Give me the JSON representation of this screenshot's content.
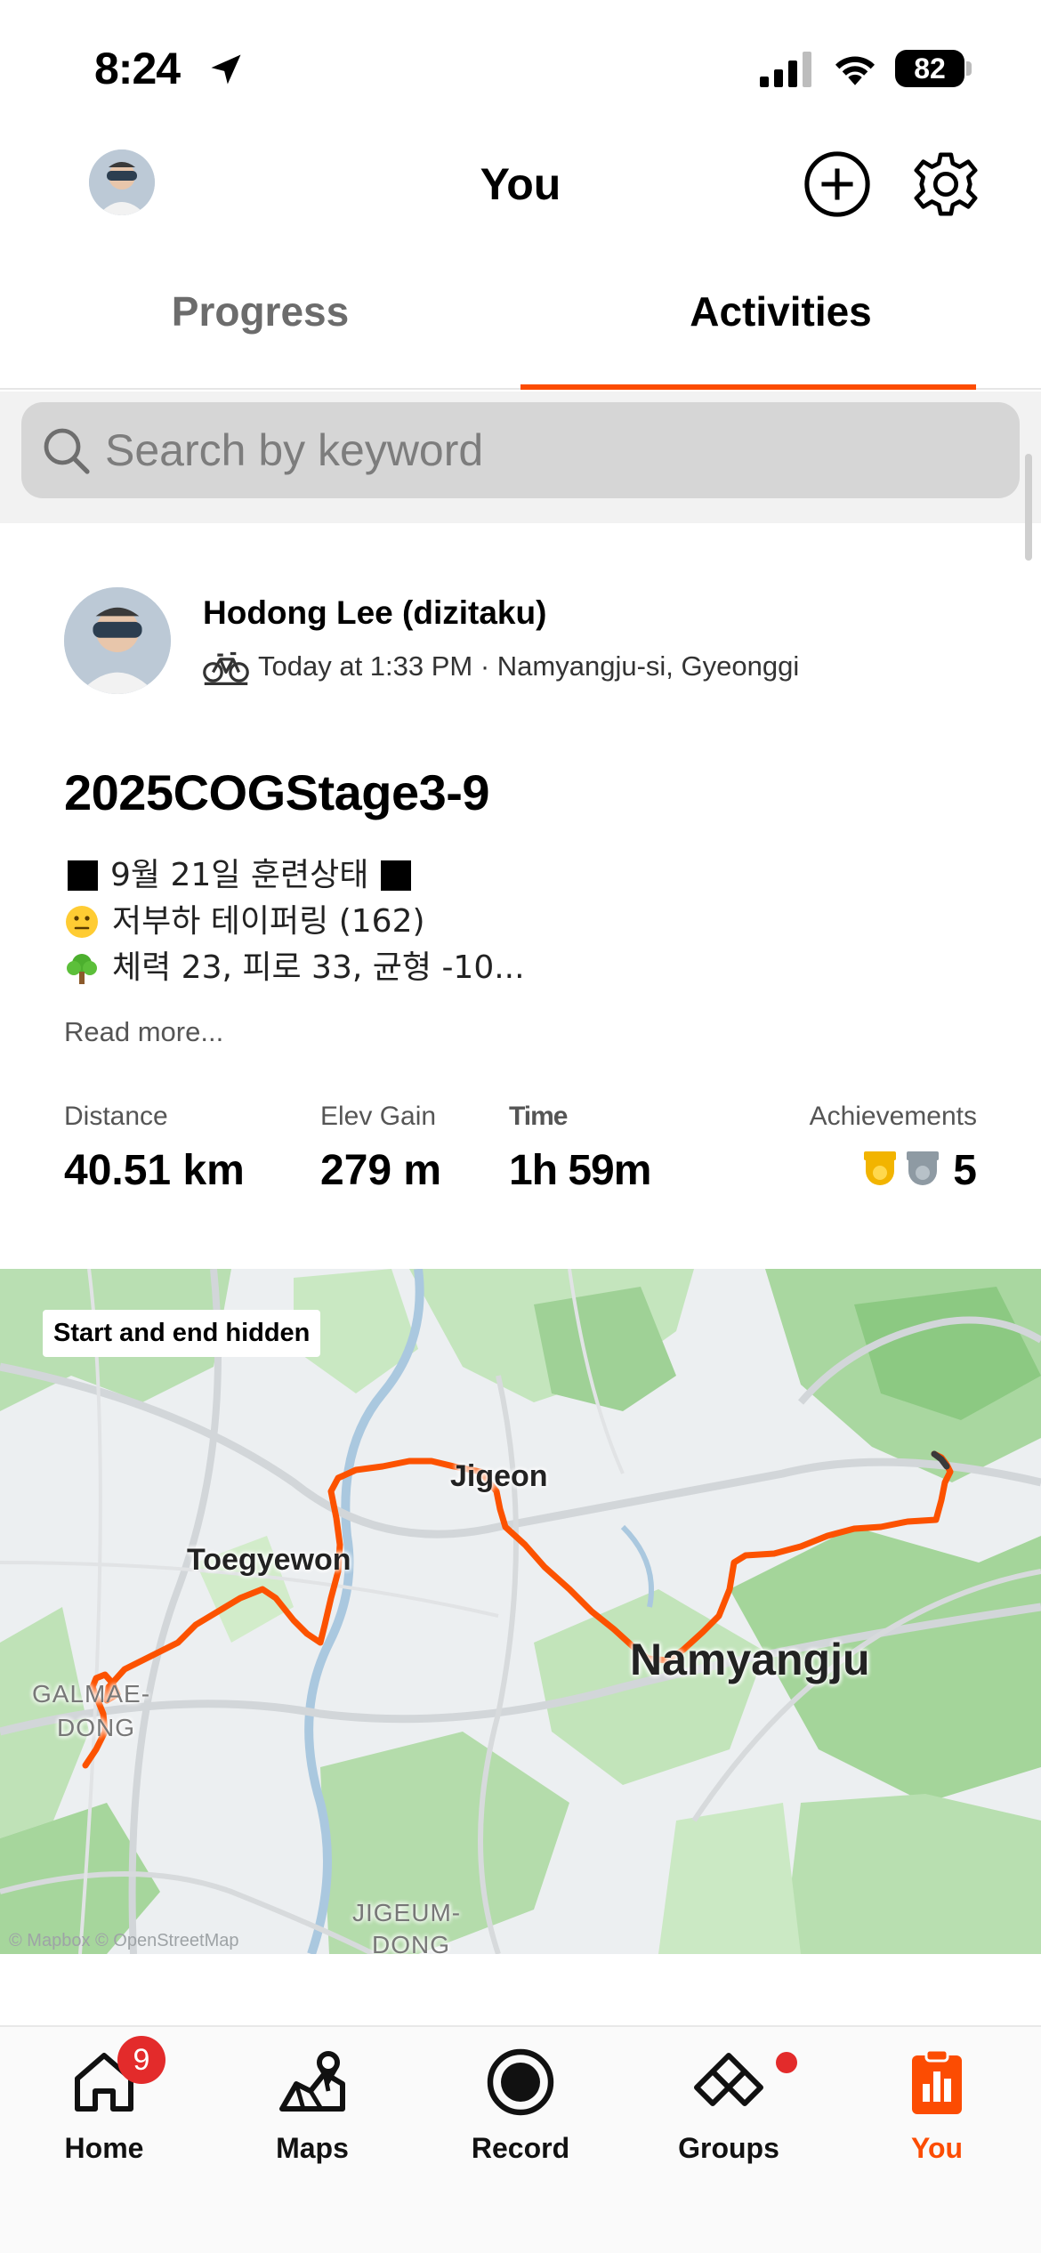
{
  "status_bar": {
    "time": "8:24",
    "battery": "82"
  },
  "header": {
    "title": "You"
  },
  "tabs": [
    {
      "label": "Progress",
      "active": false
    },
    {
      "label": "Activities",
      "active": true
    }
  ],
  "search": {
    "placeholder": "Search by keyword"
  },
  "activity": {
    "athlete_name": "Hodong Lee (dizitaku)",
    "meta": "Today at 1:33 PM · Namyangju-si, Gyeonggi",
    "title": "2025COGStage3-9",
    "description": {
      "line1": "9월 21일 훈련상태",
      "line2": "저부하 테이퍼링 (162)",
      "line3": "체력 23, 피로 33, 균형 -10..."
    },
    "read_more": "Read more...",
    "stats": {
      "distance": {
        "label": "Distance",
        "value": "40.51 km"
      },
      "elev_gain": {
        "label": "Elev Gain",
        "value": "279 m"
      },
      "time": {
        "label": "Time",
        "value": "1h 59m"
      },
      "achievements": {
        "label": "Achievements",
        "count": "5"
      }
    },
    "map": {
      "privacy_label": "Start and end hidden",
      "places": [
        "Jigeon",
        "Toegyewon",
        "Namyangju",
        "GALMAE-",
        "DONG",
        "JIGEUM-",
        "DONG"
      ],
      "attribution": "© Mapbox © OpenStreetMap"
    }
  },
  "nav": {
    "home": {
      "label": "Home",
      "badge": "9"
    },
    "maps": {
      "label": "Maps"
    },
    "record": {
      "label": "Record"
    },
    "groups": {
      "label": "Groups"
    },
    "you": {
      "label": "You"
    }
  },
  "colors": {
    "accent": "#fc4c02",
    "route": "#fc5200",
    "badge": "#e32b2b"
  }
}
